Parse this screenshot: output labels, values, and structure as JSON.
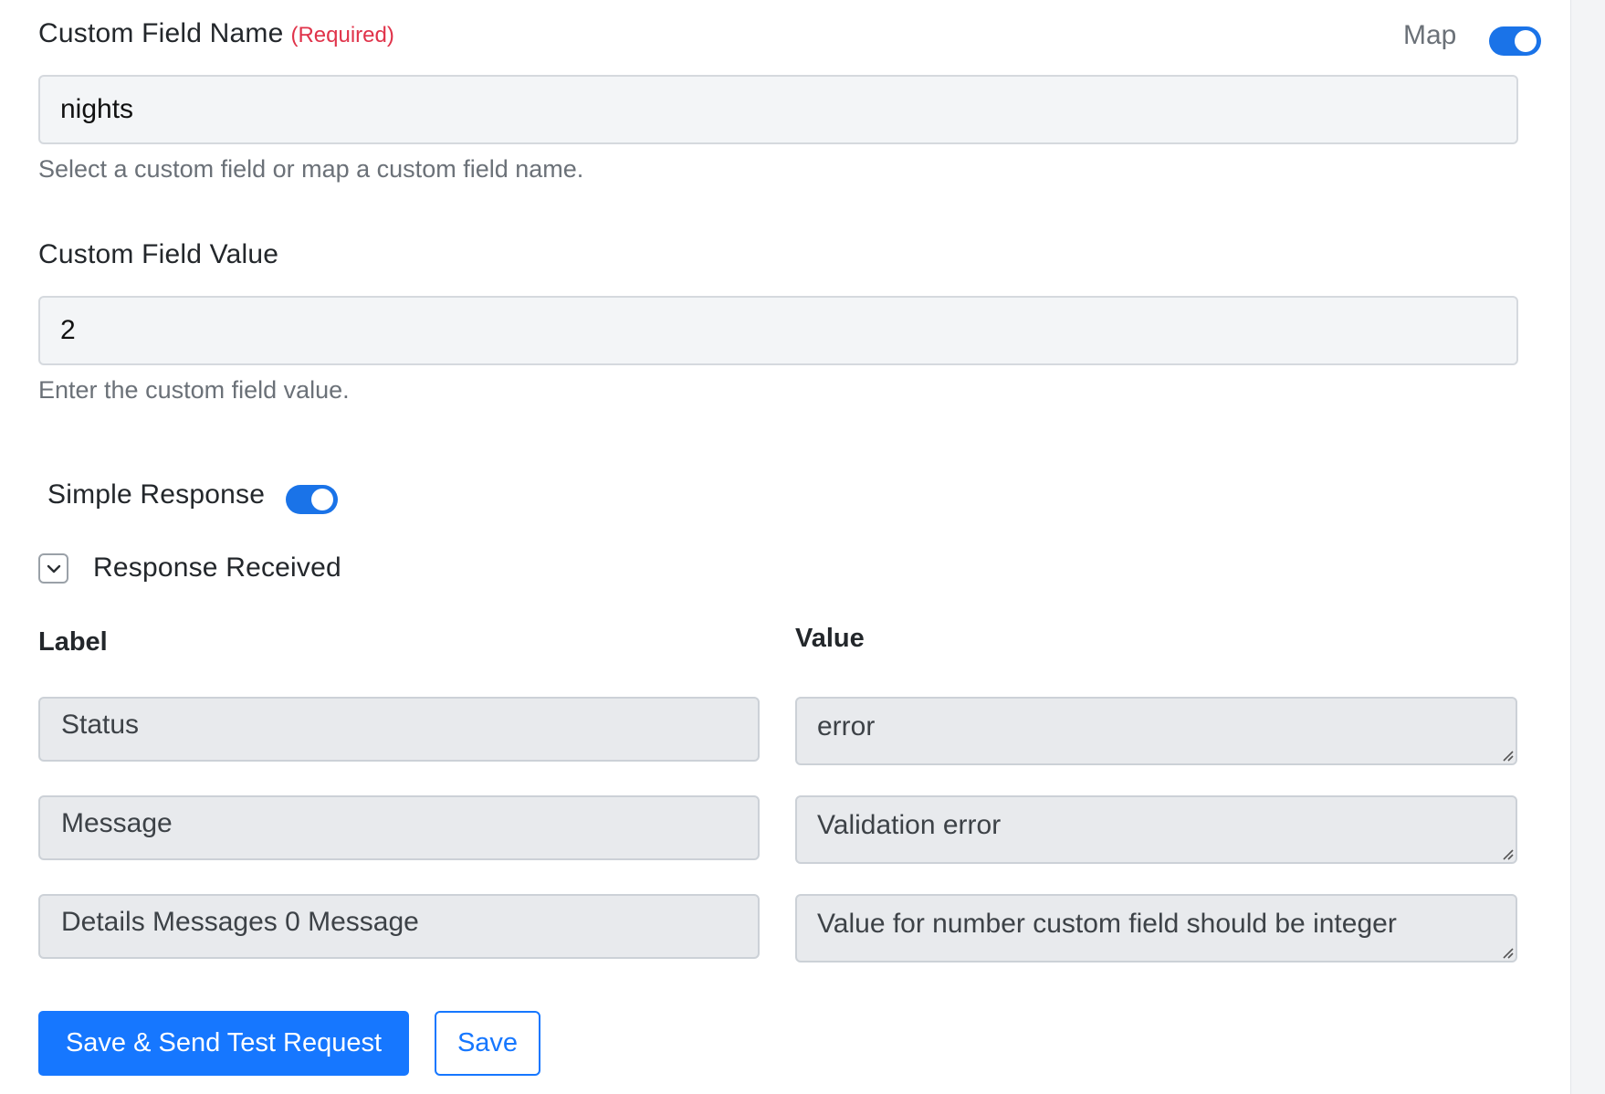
{
  "custom_field_name": {
    "label": "Custom Field Name",
    "required_text": "(Required)",
    "map_label": "Map",
    "map_enabled": true,
    "value": "nights",
    "help": "Select a custom field or map a custom field name."
  },
  "custom_field_value": {
    "label": "Custom Field Value",
    "value": "2",
    "help": "Enter the custom field value."
  },
  "simple_response": {
    "label": "Simple Response",
    "enabled": true
  },
  "response_received": {
    "label": "Response Received",
    "expanded": true
  },
  "response_table": {
    "label_header": "Label",
    "value_header": "Value",
    "rows": [
      {
        "label": "Status",
        "value": "error"
      },
      {
        "label": "Message",
        "value": "Validation error"
      },
      {
        "label": "Details Messages 0 Message",
        "value": "Value for number custom field should be integer"
      }
    ]
  },
  "actions": {
    "save_send_label": "Save & Send Test Request",
    "save_label": "Save"
  },
  "colors": {
    "accent": "#1677ff",
    "required": "#e0334a"
  }
}
